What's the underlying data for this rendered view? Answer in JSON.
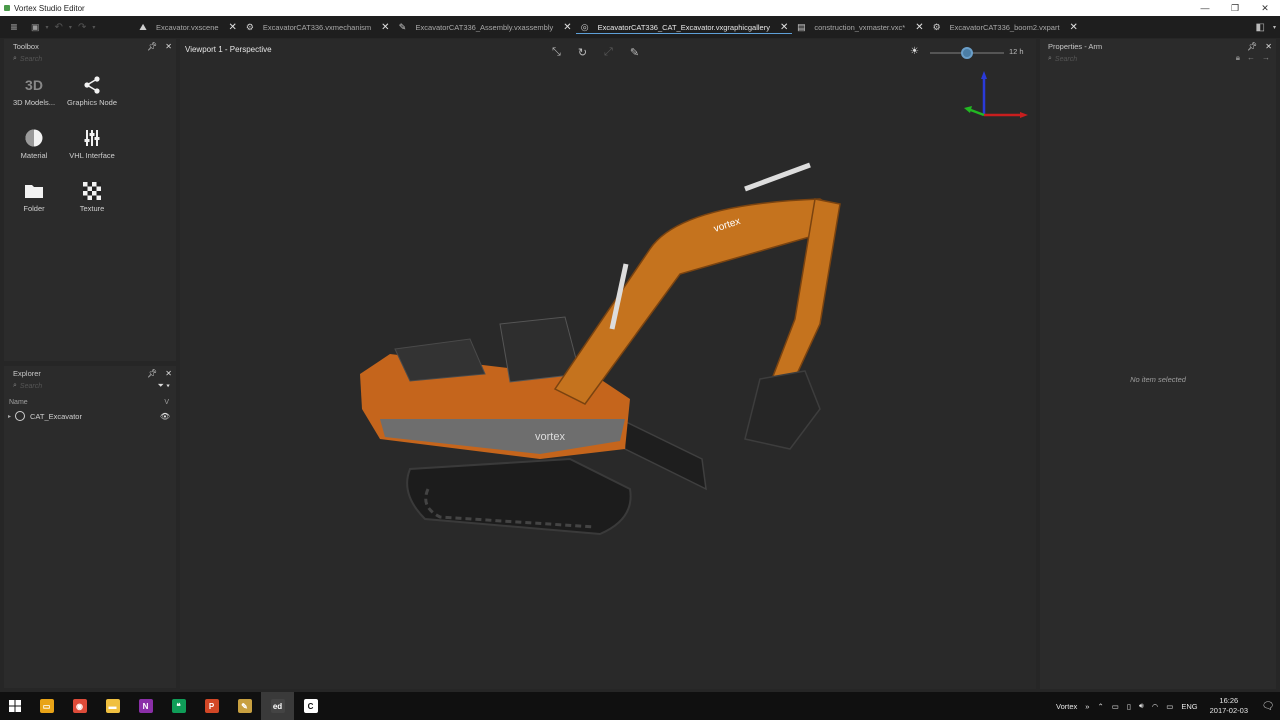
{
  "window": {
    "title": "Vortex Studio Editor",
    "controls": [
      "—",
      "❐",
      "✕"
    ]
  },
  "toolbar": {
    "menu_icon": "≡",
    "save_icon": "💾",
    "undo_icon": "↶",
    "redo_icon": "↷"
  },
  "tabs": [
    {
      "label": "Excavator.vxscene",
      "icon": "⛰",
      "active": false
    },
    {
      "label": "ExcavatorCAT336.vxmechanism",
      "icon": "⚙",
      "active": false
    },
    {
      "label": "ExcavatorCAT336_Assembly.vxassembly",
      "icon": "✎",
      "active": false
    },
    {
      "label": "ExcavatorCAT336_CAT_Excavator.vxgraphicgallery",
      "icon": "◎",
      "active": true
    },
    {
      "label": "construction_vxmaster.vxc*",
      "icon": "▤",
      "active": false
    },
    {
      "label": "ExcavatorCAT336_boom2.vxpart",
      "icon": "⚙",
      "active": false
    }
  ],
  "toolbox": {
    "title": "Toolbox",
    "search_placeholder": "Search",
    "items": [
      {
        "label": "3D Models...",
        "icon": "3D"
      },
      {
        "label": "Graphics Node",
        "icon": "share-icon"
      },
      {
        "label": "Material",
        "icon": "material-icon"
      },
      {
        "label": "VHL Interface",
        "icon": "sliders-icon"
      },
      {
        "label": "Folder",
        "icon": "folder-icon"
      },
      {
        "label": "Texture",
        "icon": "checker-icon"
      }
    ]
  },
  "explorer": {
    "title": "Explorer",
    "search_placeholder": "Search",
    "columns": {
      "name": "Name",
      "v": "V"
    },
    "rows": [
      {
        "label": "CAT_Excavator"
      }
    ]
  },
  "viewport": {
    "title": "Viewport 1 - Perspective",
    "time_label": "12 h",
    "time_of_day": 0.5,
    "brand_text": "vortex"
  },
  "properties": {
    "title": "Properties - Arm",
    "search_placeholder": "Search",
    "empty_text": "No item selected"
  },
  "taskbar": {
    "apps": [
      {
        "name": "explorer",
        "color": "#e8a317",
        "glyph": "▭"
      },
      {
        "name": "chrome",
        "color": "#dd4b39",
        "glyph": "◉"
      },
      {
        "name": "file-explorer",
        "color": "#f0c040",
        "glyph": "▬"
      },
      {
        "name": "onenote",
        "color": "#8b2fa8",
        "glyph": "N"
      },
      {
        "name": "hangouts",
        "color": "#0f9d58",
        "glyph": "❝"
      },
      {
        "name": "powerpoint",
        "color": "#d24726",
        "glyph": "P"
      },
      {
        "name": "paint",
        "color": "#c8a040",
        "glyph": "✎"
      },
      {
        "name": "vortex-editor",
        "color": "#444444",
        "glyph": "ed"
      },
      {
        "name": "vortex-player",
        "color": "#ffffff",
        "glyph": "C"
      }
    ],
    "tray": {
      "vortex_label": "Vortex",
      "language": "ENG",
      "time": "16:26",
      "date": "2017-02-03"
    }
  }
}
